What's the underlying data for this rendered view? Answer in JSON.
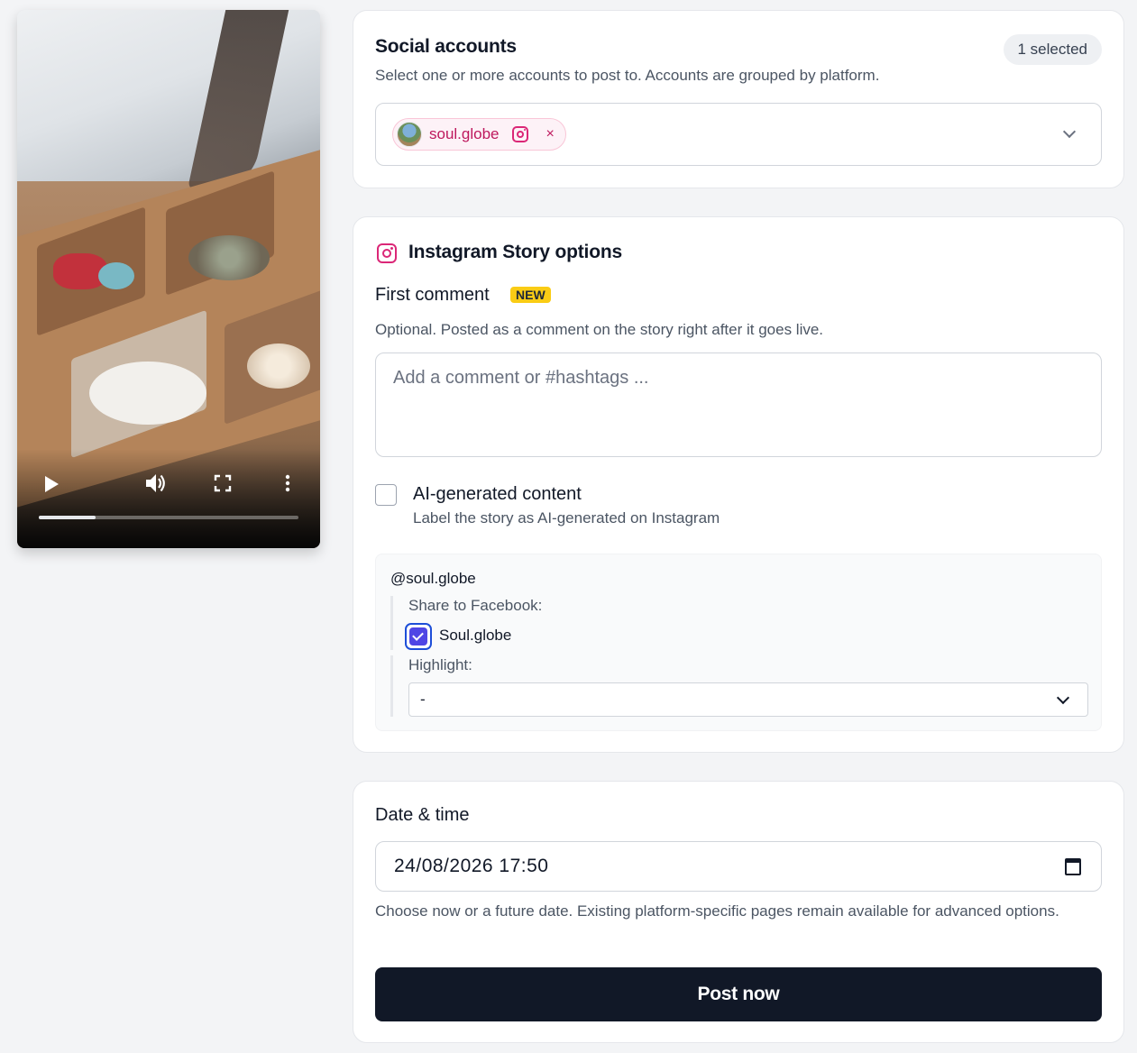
{
  "video": {
    "progress_fraction": 0.22,
    "controls": [
      "play-icon",
      "volume-icon",
      "fullscreen-icon",
      "more-vertical-icon"
    ]
  },
  "social": {
    "title": "Social accounts",
    "selected_count": "1 selected",
    "description": "Select one or more accounts to post to. Accounts are grouped by platform.",
    "chip_label": "soul.globe",
    "chip_remove": "×"
  },
  "story": {
    "title": "Instagram Story options",
    "first_comment_label": "First comment",
    "new_badge": "NEW",
    "first_comment_help": "Optional. Posted as a comment on the story right after it goes live.",
    "comment_placeholder": "Add a comment or #hashtags ...",
    "ai_label": "AI-generated content",
    "ai_help": "Label the story as AI-generated on Instagram",
    "account_handle": "@soul.globe",
    "share_label": "Share to Facebook:",
    "facebook_page": "Soul.globe",
    "highlight_label": "Highlight:",
    "highlight_value": "-"
  },
  "schedule": {
    "title": "Date & time",
    "datetime_value": "24/08/2026 17:50",
    "help": "Choose now or a future date. Existing platform-specific pages remain available for advanced options.",
    "post_button": "Post now"
  },
  "colors": {
    "accent_pink": "#db2777",
    "checkbox_blue": "#4f46e5",
    "button_dark": "#111827",
    "badge_yellow": "#facc15"
  }
}
